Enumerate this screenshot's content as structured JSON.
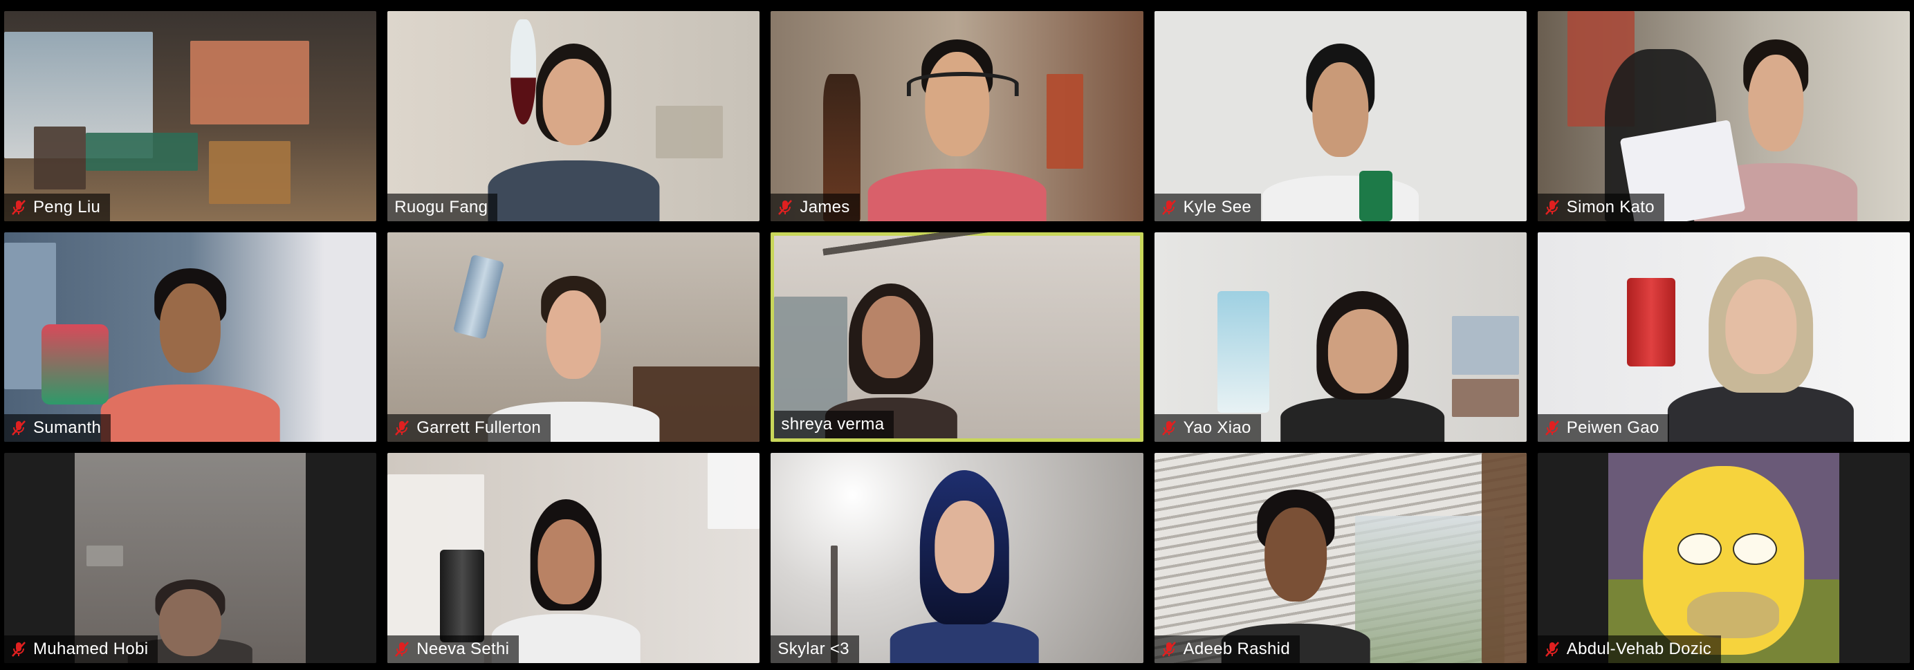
{
  "meeting": {
    "active_speaker": "shreya verma",
    "colors": {
      "active_border": "#c8d65a",
      "muted_icon": "#e02020",
      "label_bg": "rgba(0,0,0,0.62)"
    }
  },
  "participants": [
    {
      "name": "Peng Liu",
      "muted": true,
      "scene": "office"
    },
    {
      "name": "Ruogu Fang",
      "muted": false,
      "scene": "wine"
    },
    {
      "name": "James",
      "muted": true,
      "scene": "bottle"
    },
    {
      "name": "Kyle See",
      "muted": true,
      "scene": "cup"
    },
    {
      "name": "Simon Kato",
      "muted": true,
      "scene": "gamer"
    },
    {
      "name": "Sumanth",
      "muted": true,
      "scene": "mug"
    },
    {
      "name": "Garrett Fullerton",
      "muted": true,
      "scene": "can"
    },
    {
      "name": "shreya verma",
      "muted": false,
      "scene": "ceiling"
    },
    {
      "name": "Yao Xiao",
      "muted": true,
      "scene": "carton"
    },
    {
      "name": "Peiwen Gao",
      "muted": true,
      "scene": "redcan"
    },
    {
      "name": "Muhamed Hobi",
      "muted": true,
      "scene": "dim"
    },
    {
      "name": "Neeva Sethi",
      "muted": true,
      "scene": "tumbler"
    },
    {
      "name": "Skylar <3",
      "muted": false,
      "scene": "bluehair"
    },
    {
      "name": "Adeeb Rashid",
      "muted": true,
      "scene": "blinds"
    },
    {
      "name": "Abdul-Vehab Dozic",
      "muted": true,
      "scene": "homer"
    }
  ]
}
